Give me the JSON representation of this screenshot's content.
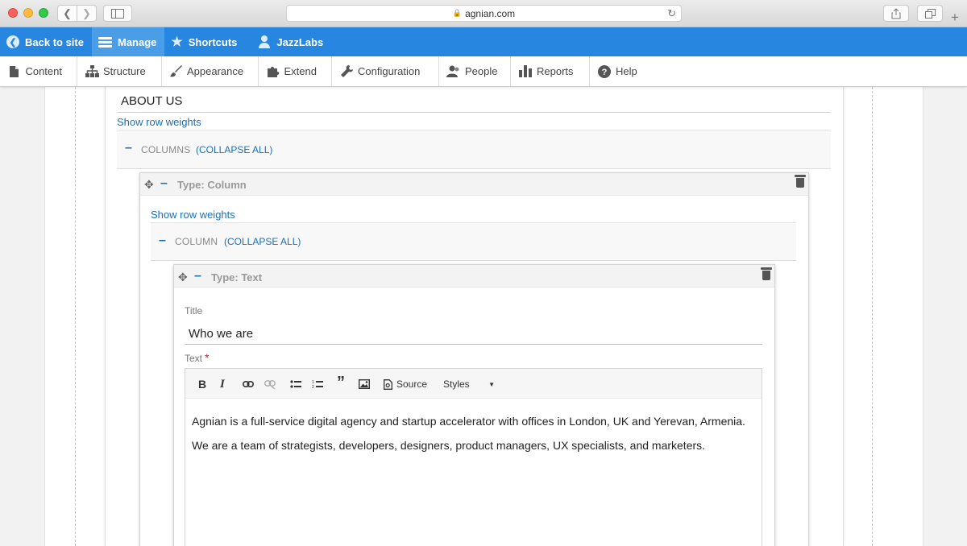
{
  "browser": {
    "url": "agnian.com"
  },
  "toolbar": {
    "back_to_site": "Back to site",
    "manage": "Manage",
    "shortcuts": "Shortcuts",
    "user": "JazzLabs"
  },
  "tray": {
    "items": [
      "Content",
      "Structure",
      "Appearance",
      "Extend",
      "Configuration",
      "People",
      "Reports",
      "Help"
    ]
  },
  "page": {
    "section_title": "ABOUT US",
    "show_row_weights_1": "Show row weights",
    "columns_label": "COLUMNS",
    "collapse_all_1": "(COLLAPSE ALL)",
    "column_card_type": "Type: Column",
    "show_row_weights_2": "Show row weights",
    "column_label": "COLUMN",
    "collapse_all_2": "(COLLAPSE ALL)",
    "text_card_type": "Type: Text",
    "title_label": "Title",
    "title_value": "Who we are",
    "text_label": "Text",
    "required_mark": "*"
  },
  "editor": {
    "source_label": "Source",
    "styles_label": "Styles",
    "paragraphs": [
      "Agnian is a full-service digital agency and startup accelerator with offices in London, UK and Yerevan, Armenia.",
      "We are a team of strategists, developers, designers, product managers, UX specialists, and marketers."
    ]
  },
  "colors": {
    "toolbar_blue": "#2787e0",
    "link_blue": "#1a6fb5",
    "required_red": "#e0211c"
  }
}
